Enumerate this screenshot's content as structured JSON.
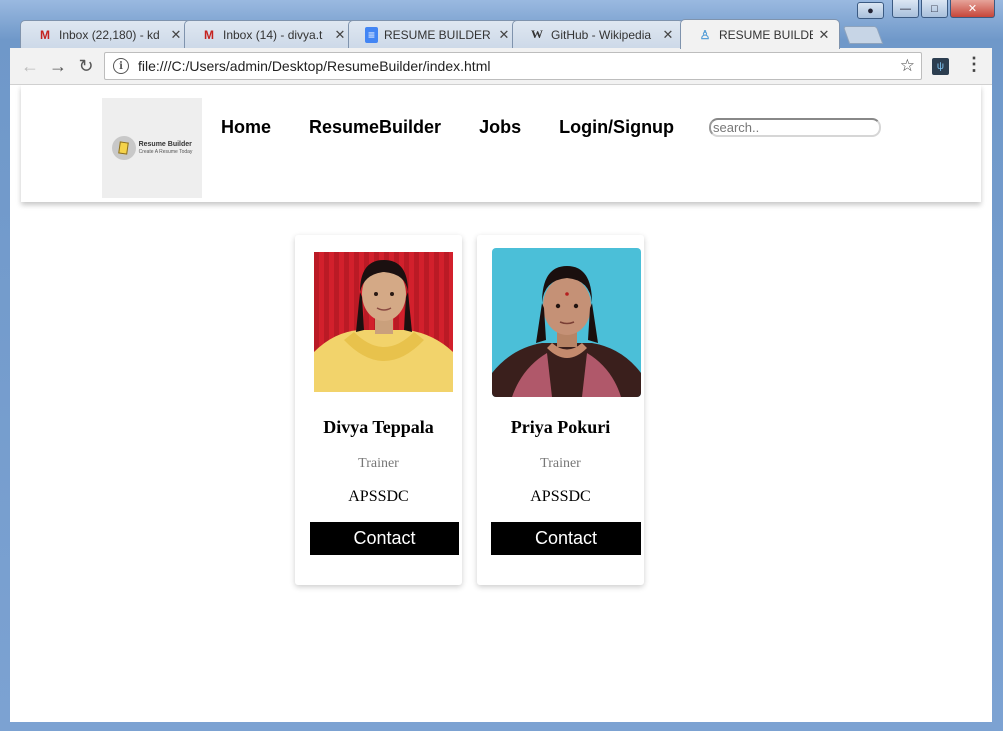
{
  "browser": {
    "tabs": [
      {
        "label": "Inbox (22,180) - kd",
        "icon": "gmail-icon",
        "glyph": "M",
        "color": "#c5221f"
      },
      {
        "label": "Inbox (14) - divya.t",
        "icon": "gmail-icon",
        "glyph": "M",
        "color": "#c5221f"
      },
      {
        "label": "RESUME BUILDER P",
        "icon": "docs-icon",
        "glyph": "≡",
        "color": "#4285f4"
      },
      {
        "label": "GitHub - Wikipedia",
        "icon": "wikipedia-icon",
        "glyph": "W",
        "color": "#222222"
      },
      {
        "label": "RESUME BUILDER",
        "icon": "page-icon",
        "glyph": "♙",
        "color": "#5aa0d8"
      }
    ],
    "url": "file:///C:/Users/admin/Desktop/ResumeBuilder/index.html"
  },
  "site": {
    "logo": {
      "title": "Resume Builder",
      "subtitle": "Create A Resume Today"
    },
    "nav": [
      "Home",
      "ResumeBuilder",
      "Jobs",
      "Login/Signup"
    ],
    "search_placeholder": "search.."
  },
  "cards": [
    {
      "name": "Divya Teppala",
      "title": "Trainer",
      "org": "APSSDC",
      "button": "Contact"
    },
    {
      "name": "Priya Pokuri",
      "title": "Trainer",
      "org": "APSSDC",
      "button": "Contact"
    }
  ]
}
